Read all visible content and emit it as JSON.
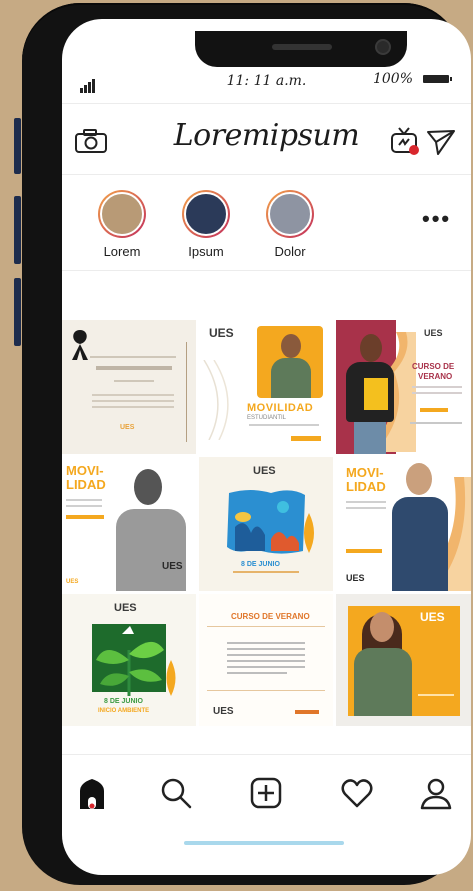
{
  "status_bar": {
    "time": "11: 11 a.m.",
    "battery": "100%"
  },
  "app": {
    "brand": "Loremipsum"
  },
  "stories": [
    {
      "label": "Lorem",
      "color": "#b89a76"
    },
    {
      "label": "Ipsum",
      "color": "#2b3a59"
    },
    {
      "label": "Dolor",
      "color": "#8e94a2"
    }
  ],
  "posts": {
    "brand_mark": "UES",
    "movilidad": "MOVILIDAD",
    "movilidad_sub": "ESTUDIANTIL",
    "movi": "MOVI-",
    "lidad": "LIDAD",
    "curso_verano": "CURSO DE VERANO",
    "curso": "CURSO DE",
    "verano": "VERANO",
    "date_1": "8 DE JUNIO",
    "date_2": "8 DE JUNIO",
    "cta": "INICIO AMBIENTE"
  },
  "nav": {
    "items": [
      "home",
      "search",
      "add",
      "likes",
      "profile"
    ]
  },
  "colors": {
    "accent": "#f5a623",
    "brand_red": "#c0392b",
    "background": "#c6aa84"
  }
}
